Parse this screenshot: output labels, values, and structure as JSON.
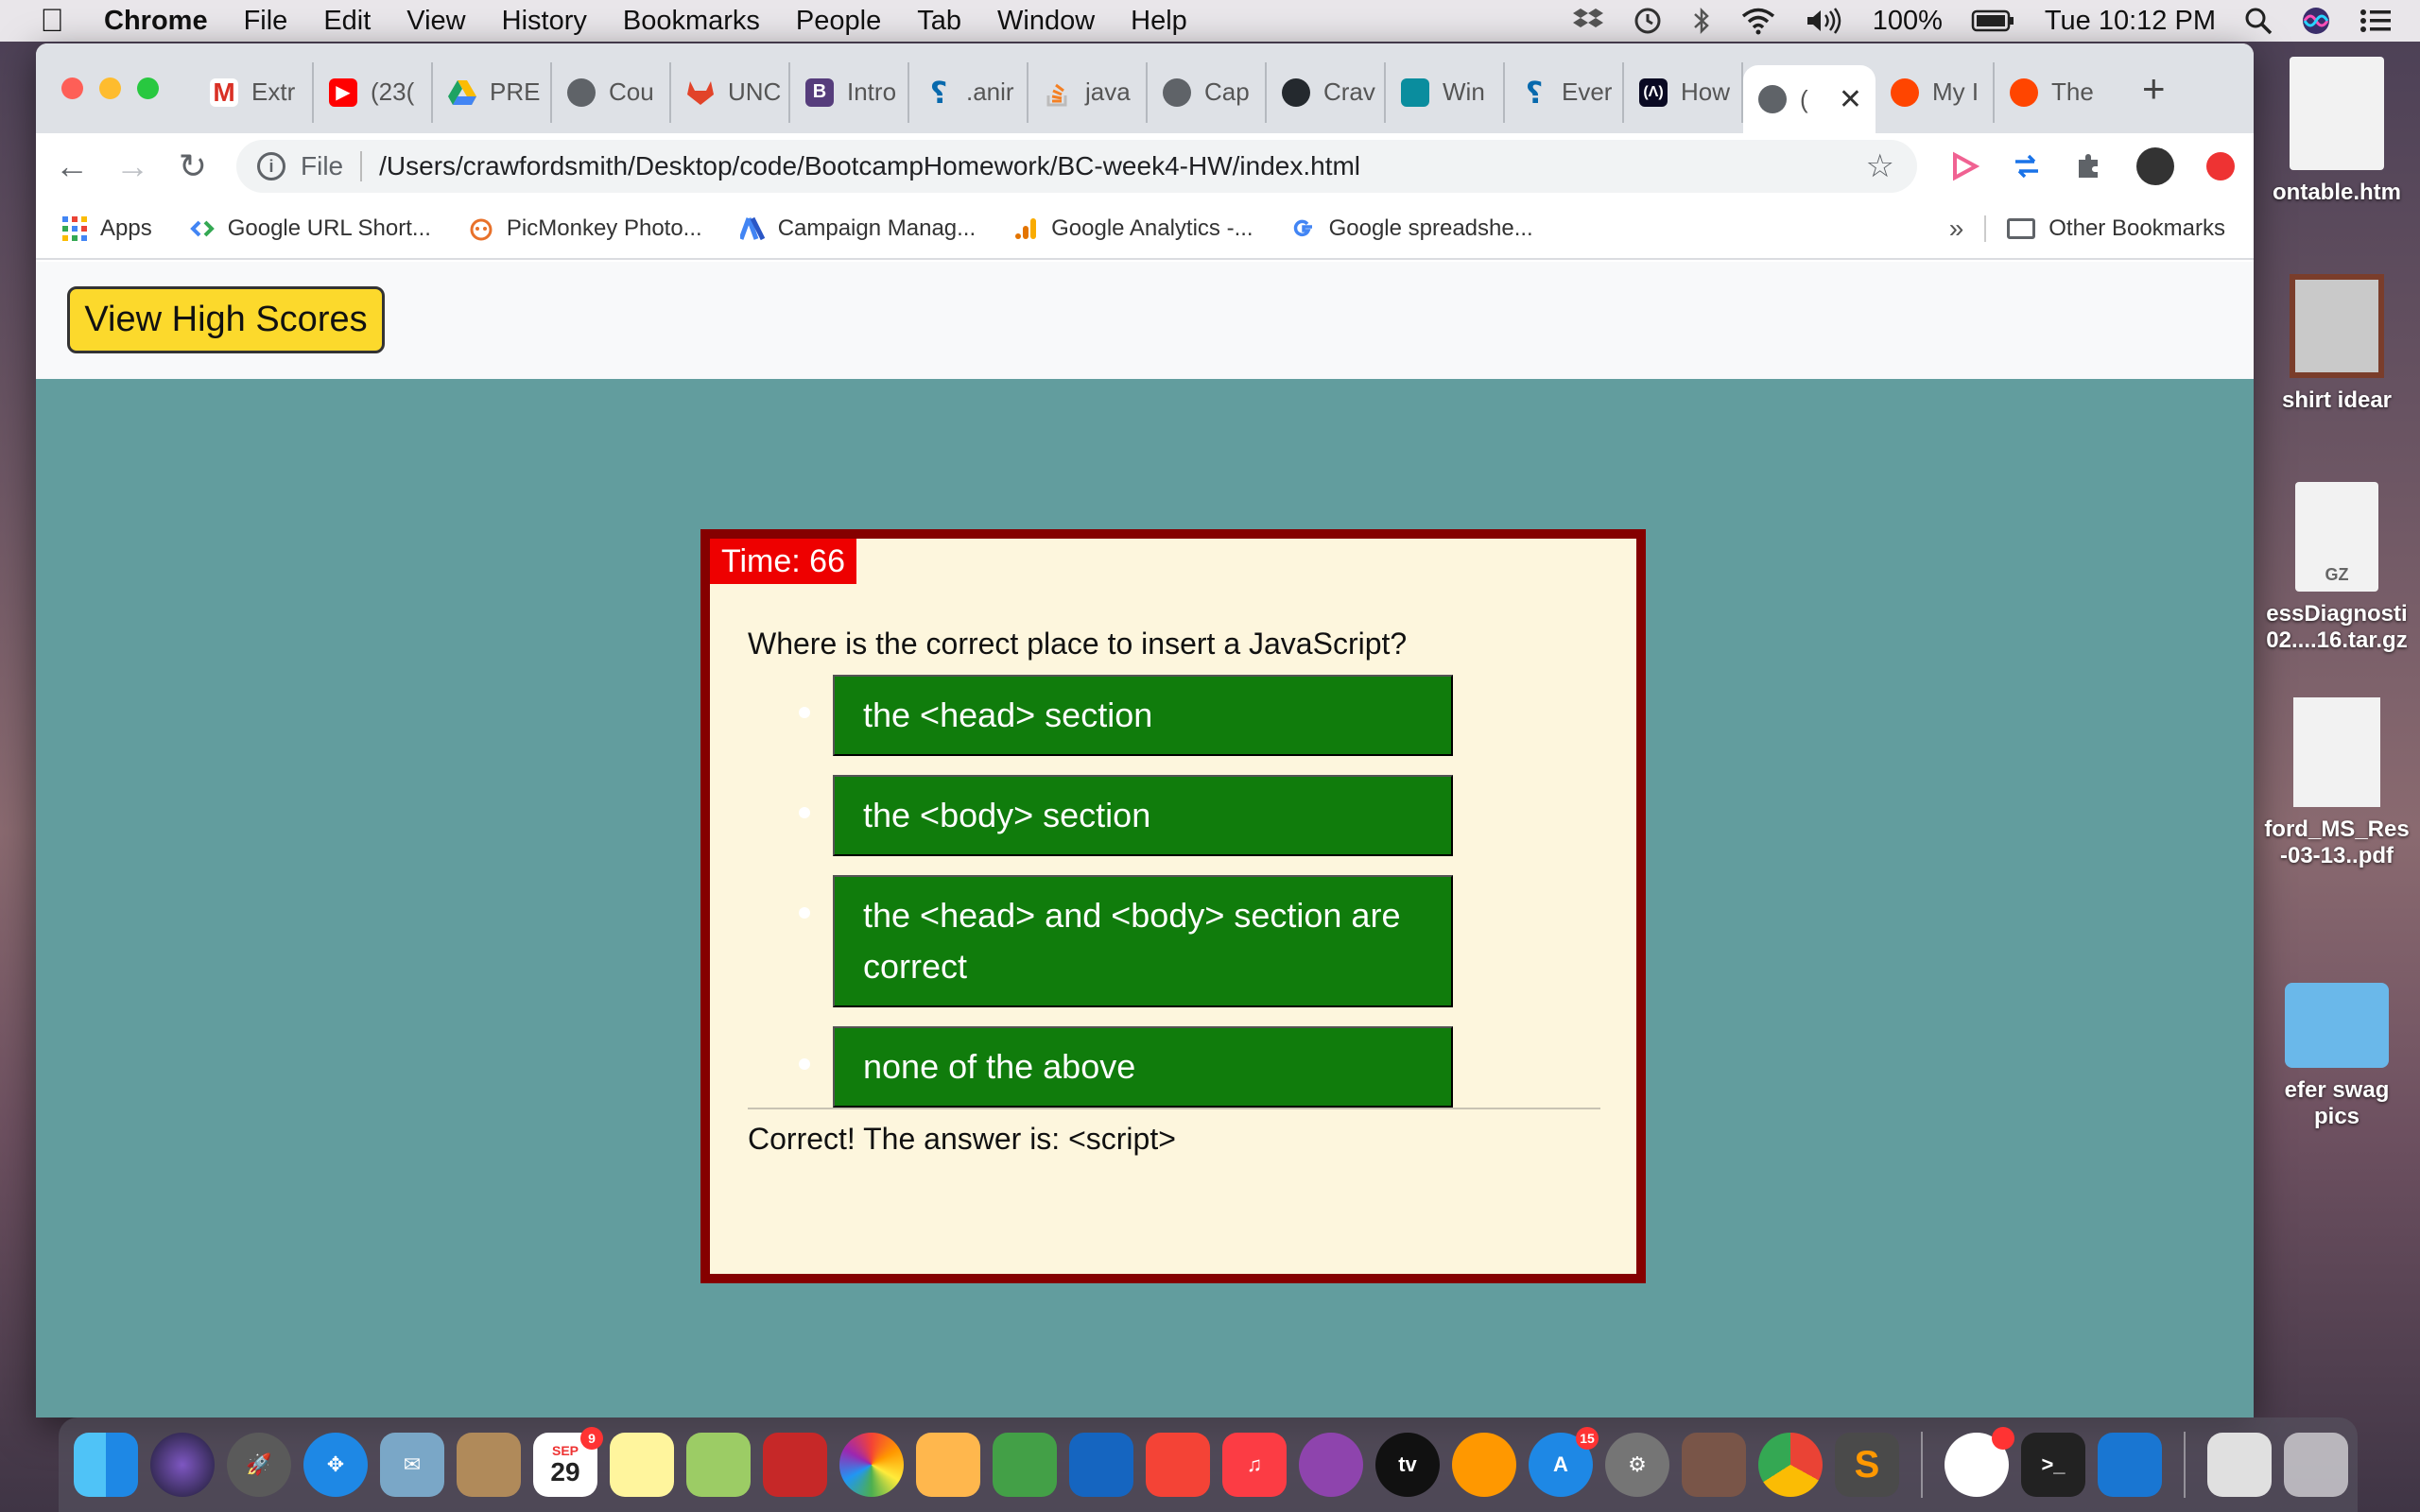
{
  "menubar": {
    "app": "Chrome",
    "menus": [
      "File",
      "Edit",
      "View",
      "History",
      "Bookmarks",
      "People",
      "Tab",
      "Window",
      "Help"
    ],
    "battery": "100%",
    "clock": "Tue 10:12 PM"
  },
  "tabs": [
    {
      "label": "Extr",
      "icon": "gmail-icon",
      "color": "#d93025"
    },
    {
      "label": "(23(",
      "icon": "youtube-icon",
      "color": "#ff0000"
    },
    {
      "label": "PRE",
      "icon": "google-drive-icon",
      "color": "#1ea362"
    },
    {
      "label": "Cou",
      "icon": "globe-icon",
      "color": "#5f6368"
    },
    {
      "label": "UNC",
      "icon": "gitlab-icon",
      "color": "#e24329"
    },
    {
      "label": "Intro",
      "icon": "bootstrap-icon",
      "color": "#563d7c"
    },
    {
      "label": ".anir",
      "icon": "jquery-icon",
      "color": "#0769ad"
    },
    {
      "label": "java",
      "icon": "stackoverflow-icon",
      "color": "#f48024"
    },
    {
      "label": "Cap",
      "icon": "globe-icon",
      "color": "#5f6368"
    },
    {
      "label": "Crav",
      "icon": "github-icon",
      "color": "#24292e"
    },
    {
      "label": "Win",
      "icon": "mdn-icon",
      "color": "#0a8d9e"
    },
    {
      "label": "Ever",
      "icon": "jquery-icon",
      "color": "#0769ad"
    },
    {
      "label": "How",
      "icon": "freecodecamp-icon",
      "color": "#0a0a23"
    },
    {
      "label": "(",
      "icon": "globe-icon",
      "color": "#5f6368",
      "active": true
    },
    {
      "label": "My I",
      "icon": "reddit-icon",
      "color": "#ff4500"
    },
    {
      "label": "The",
      "icon": "reddit-icon",
      "color": "#ff4500"
    }
  ],
  "toolbar": {
    "scheme": "File",
    "url": "/Users/crawfordsmith/Desktop/code/BootcampHomework/BC-week4-HW/index.html"
  },
  "bookmarks": {
    "items": [
      "Apps",
      "Google URL Short...",
      "PicMonkey Photo...",
      "Campaign Manag...",
      "Google Analytics -...",
      "Google spreadshe..."
    ],
    "more": "»",
    "other": "Other Bookmarks"
  },
  "page": {
    "high_scores_label": "View High Scores",
    "timer_label": "Time: 66",
    "question": "Where is the correct place to insert a JavaScript?",
    "choices": [
      "the <head> section",
      "the <body> section",
      "the <head> and <body> section are correct",
      "none of the above"
    ],
    "feedback": "Correct! The answer is: <script>"
  },
  "desktop": [
    "ontable.htm",
    "shirt idear",
    "essDiagnosti",
    "02....16.tar.gz",
    "ford_MS_Res",
    "-03-13..pdf",
    "efer swag",
    "pics"
  ],
  "desktop_thumb_labels": {
    "gz": "GZ",
    "cal_month": "SEP",
    "cal_day": "29",
    "cal_badge": "9",
    "appstore_badge": "15",
    "tv": "tv"
  },
  "colors": {
    "page_bg": "#629d9e",
    "quiz_border": "#850000",
    "quiz_bg": "#fdf6dd",
    "timer_bg": "#ee0000",
    "choice_bg": "#107c0c",
    "high_scores_bg": "#fcd92c"
  }
}
